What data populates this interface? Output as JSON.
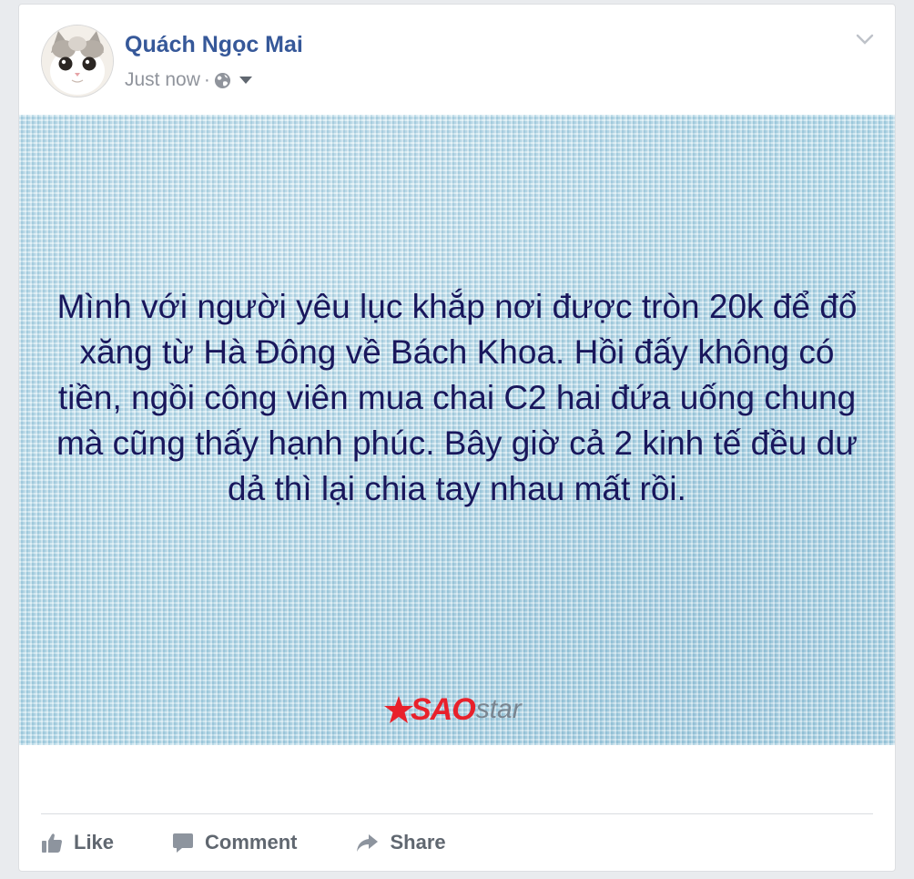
{
  "post": {
    "author": "Quách Ngọc Mai",
    "timestamp": "Just now",
    "separator": "·",
    "privacy_icon": "globe-icon",
    "options_icon": "chevron-down-icon",
    "image_text": "Mình với người yêu lục khắp nơi được tròn 20k để đổ xăng từ Hà Đông về Bách Khoa. Hồi đấy không có tiền, ngồi công viên mua chai C2 hai đứa uống chung mà cũng thấy hạnh phúc. Bây giờ cả 2 kinh tế đều dư dả thì lại chia tay nhau mất rồi.",
    "watermark": {
      "brand_red": "SAO",
      "brand_grey": "star"
    }
  },
  "actions": {
    "like_label": "Like",
    "comment_label": "Comment",
    "share_label": "Share"
  },
  "colors": {
    "author_link": "#365899",
    "meta_text": "#90949c",
    "image_text": "#19175c",
    "image_background": "#b8dbe9",
    "action_text": "#606770",
    "watermark_red": "#e8212b"
  }
}
